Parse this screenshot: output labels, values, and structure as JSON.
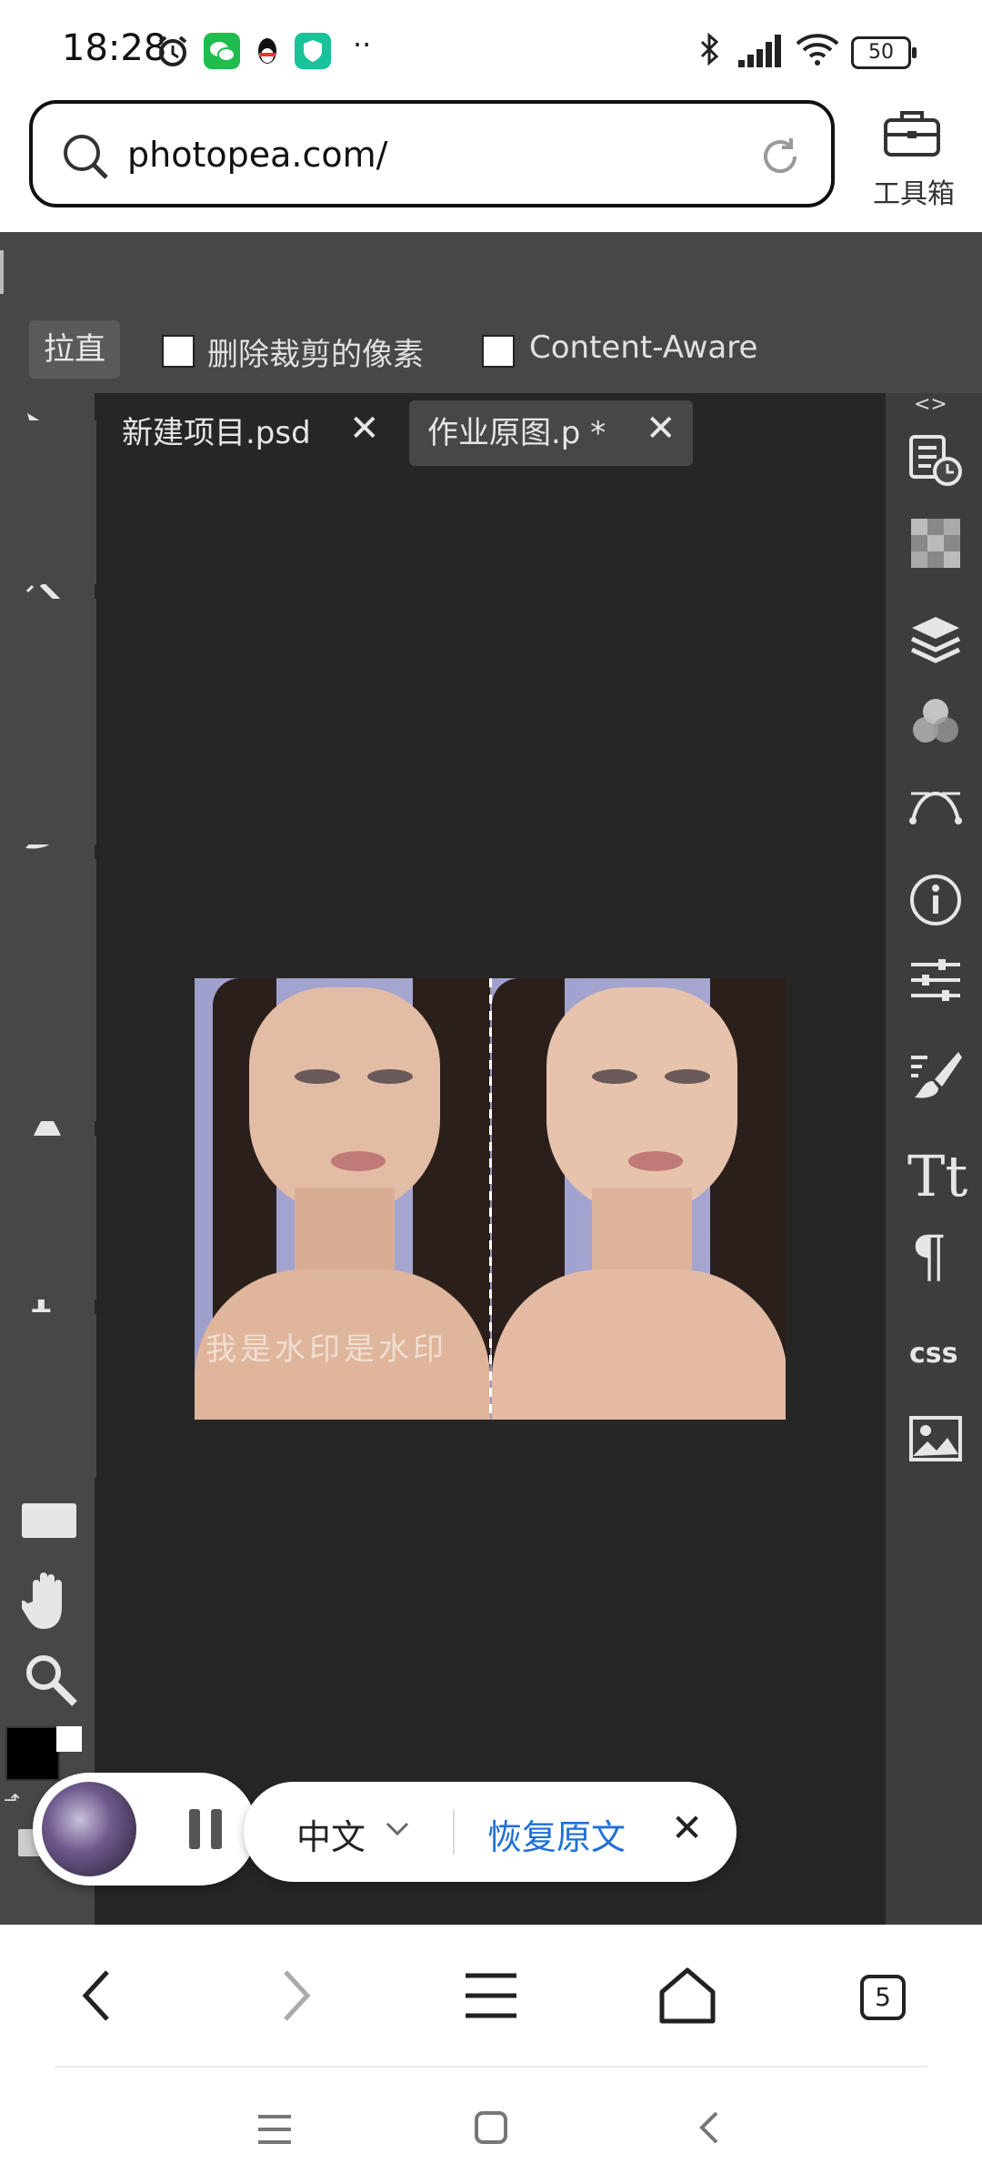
{
  "status_bar": {
    "time": "18:28",
    "battery": "50",
    "left_icons": [
      "alarm-icon",
      "wechat-icon",
      "qq-icon",
      "vpn-shield-icon",
      "more-dots-icon"
    ],
    "right_icons": [
      "bluetooth-icon",
      "signal-icon",
      "wifi-icon",
      "battery-icon"
    ]
  },
  "browser": {
    "url": "photopea.com/",
    "toolbox_label": "工具箱"
  },
  "photopea": {
    "options": {
      "straighten_label": "拉直",
      "delete_cropped_label": "删除裁剪的像素",
      "content_aware_label": "Content-Aware"
    },
    "tabs": [
      {
        "label": "新建项目.psd",
        "close": "✕"
      },
      {
        "label": "作业原图.p *",
        "close": "✕"
      }
    ],
    "panel_toggle": "<>",
    "tools": [
      "move-tool",
      "lasso-tool",
      "magic-wand-tool",
      "crop-tool",
      "marquee-tool",
      "brush-tool",
      "stamp-tool",
      "eraser-tool",
      "gradient-tool",
      "blur-tool",
      "dodge-tool",
      "type-tool",
      "pen-tool",
      "path-select-tool",
      "shape-tool",
      "hand-tool",
      "zoom-tool"
    ],
    "active_tool": "crop-tool",
    "right_panel_icons": [
      "history-icon",
      "swatches-icon",
      "layers-icon",
      "channels-icon",
      "paths-icon",
      "info-icon",
      "adjustments-icon",
      "brush-settings-icon",
      "character-icon",
      "paragraph-icon",
      "css-icon",
      "image-icon"
    ],
    "css_label": "css",
    "watermark": "我是水印是水印",
    "foreground_color": "#000000",
    "background_color": "#ffffff"
  },
  "translate_bar": {
    "language": "中文",
    "restore_label": "恢复原文",
    "close": "✕"
  },
  "browser_nav": {
    "tab_count": "5"
  },
  "colors": {
    "accent": "#3f87ff",
    "link": "#1f6fd8",
    "panel": "#474747",
    "canvas": "#262626"
  }
}
